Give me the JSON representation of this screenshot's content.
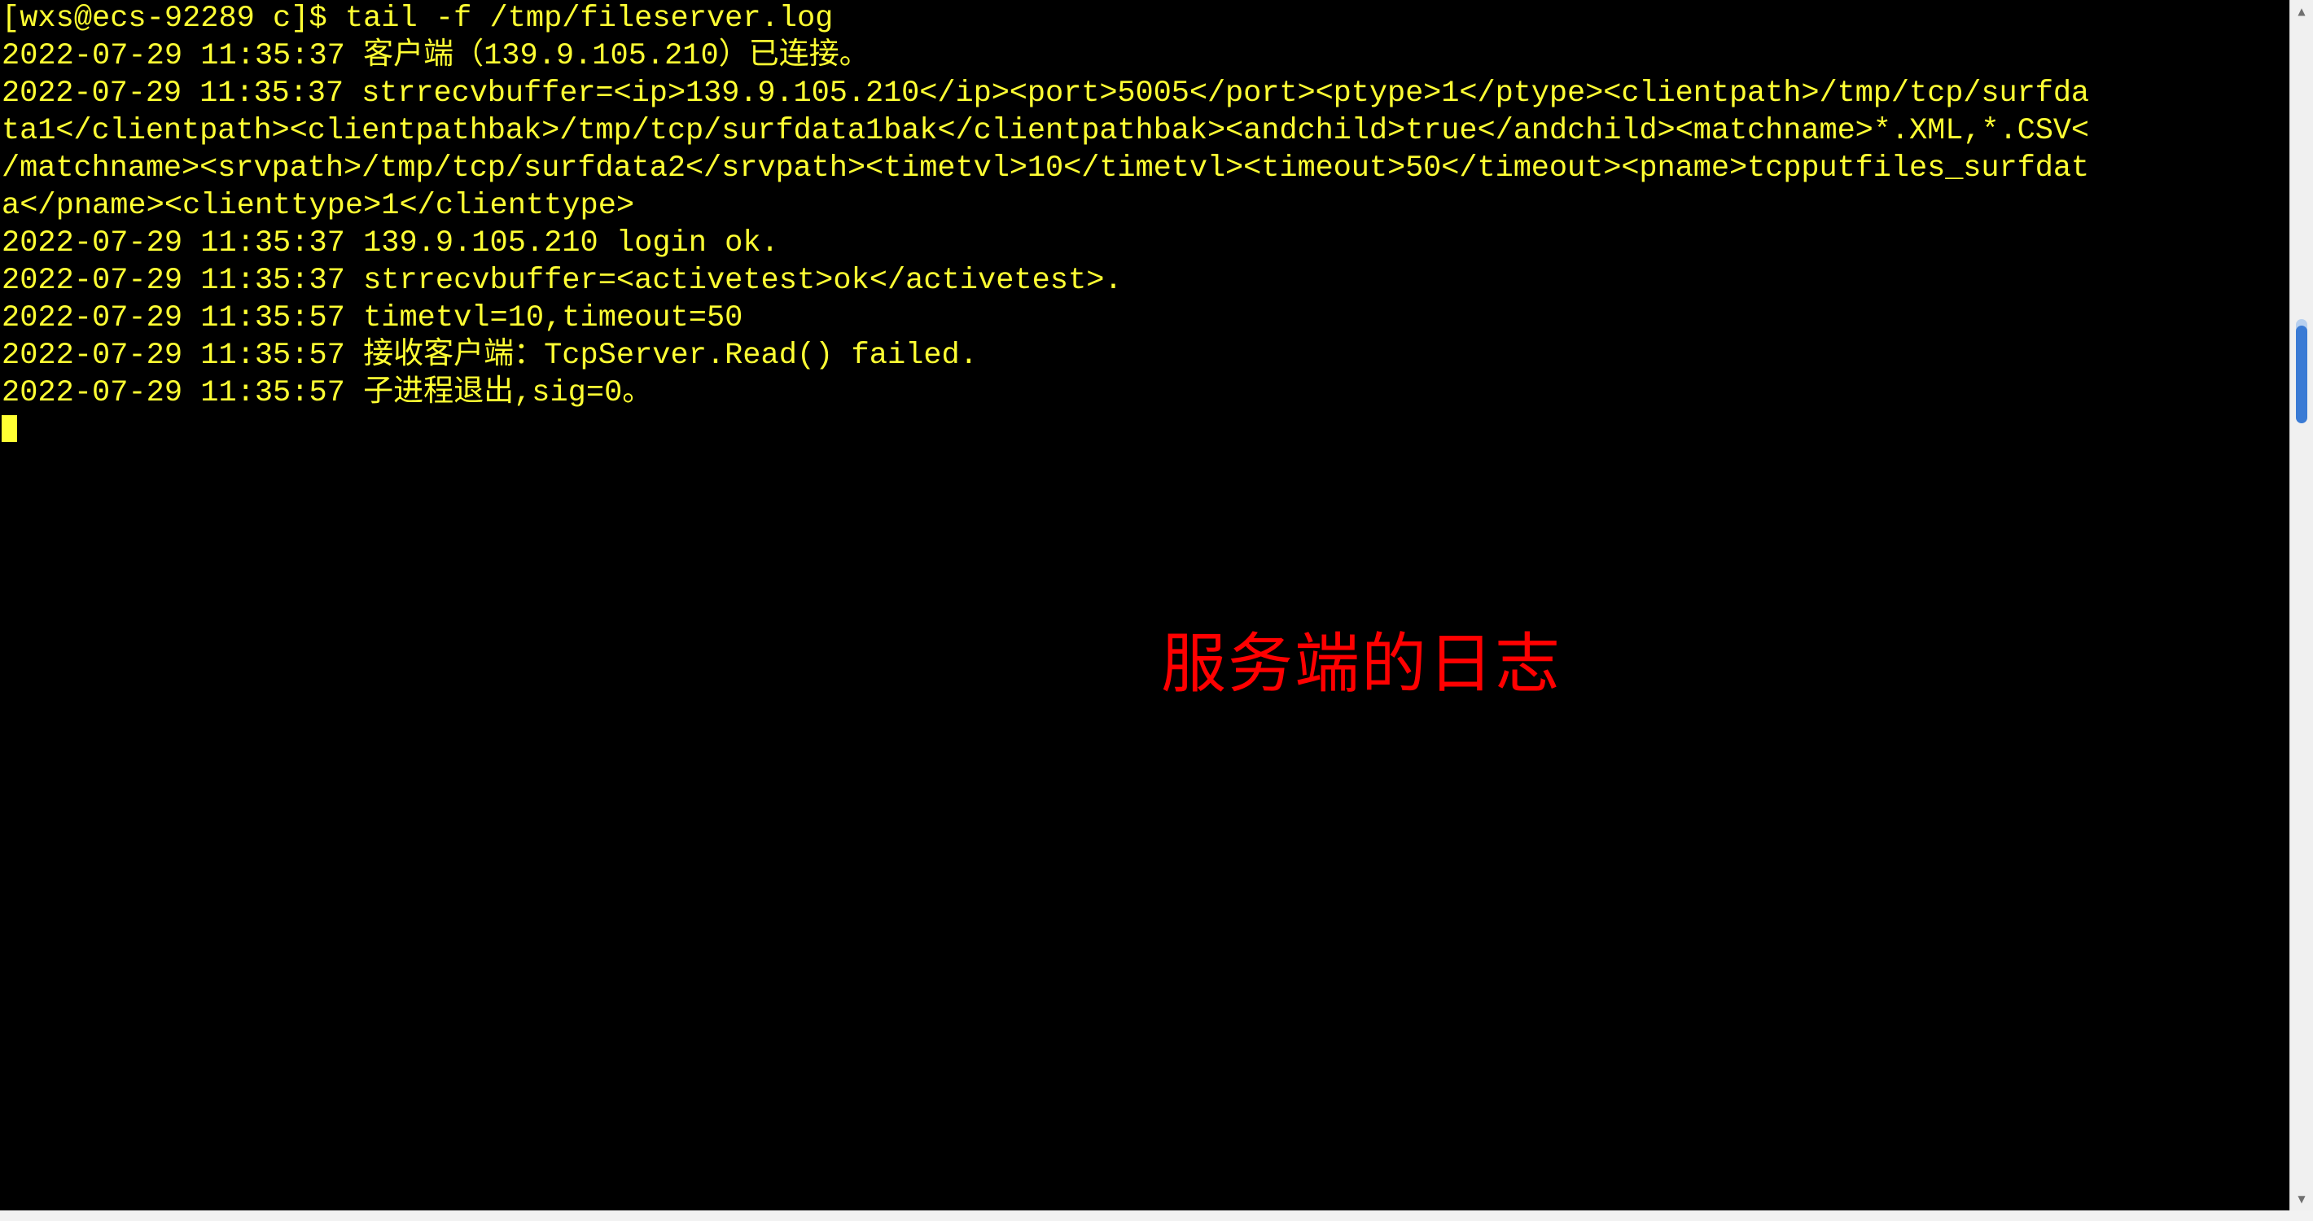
{
  "window": {
    "background_color": "#000000",
    "foreground_color": "#ffff33",
    "annotation_color": "#ff0000",
    "chrome_color": "#f2f2f2"
  },
  "terminal": {
    "prompt_line": "[wxs@ecs-92289 c]$ tail -f /tmp/fileserver.log",
    "lines": [
      "2022-07-29 11:35:37 客户端（139.9.105.210）已连接。",
      "2022-07-29 11:35:37 strrecvbuffer=<ip>139.9.105.210</ip><port>5005</port><ptype>1</ptype><clientpath>/tmp/tcp/surfda",
      "ta1</clientpath><clientpathbak>/tmp/tcp/surfdata1bak</clientpathbak><andchild>true</andchild><matchname>*.XML,*.CSV<",
      "/matchname><srvpath>/tmp/tcp/surfdata2</srvpath><timetvl>10</timetvl><timeout>50</timeout><pname>tcpputfiles_surfdat",
      "a</pname><clienttype>1</clienttype>",
      "2022-07-29 11:35:37 139.9.105.210 login ok.",
      "2022-07-29 11:35:37 strrecvbuffer=<activetest>ok</activetest>.",
      "2022-07-29 11:35:57 timetvl=10,timeout=50",
      "2022-07-29 11:35:57 接收客户端：TcpServer.Read() failed.",
      "2022-07-29 11:35:57 子进程退出,sig=0。"
    ],
    "cursor_visible": true
  },
  "annotation": {
    "text": "服务端的日志"
  },
  "scrollbar": {
    "up_arrow": "▲",
    "down_arrow": "▼"
  }
}
